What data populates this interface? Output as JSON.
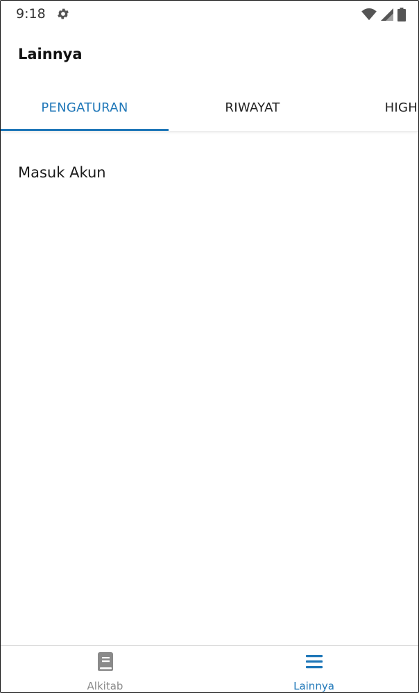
{
  "status_bar": {
    "time": "9:18",
    "icons": [
      "settings-gear-icon",
      "wifi-icon",
      "signal-icon",
      "battery-icon"
    ]
  },
  "app_bar": {
    "title": "Lainnya"
  },
  "tabs": [
    {
      "label": "PENGATURAN",
      "active": true
    },
    {
      "label": "RIWAYAT",
      "active": false
    },
    {
      "label": "HIGHLIGHT",
      "active": false
    }
  ],
  "content": {
    "items": [
      "Masuk Akun"
    ]
  },
  "bottom_nav": {
    "items": [
      {
        "label": "Alkitab",
        "icon": "book-icon",
        "active": false
      },
      {
        "label": "Lainnya",
        "icon": "menu-icon",
        "active": true
      }
    ]
  },
  "colors": {
    "accent": "#1f77b8",
    "inactive": "#8a8a8a",
    "text": "#111111"
  }
}
